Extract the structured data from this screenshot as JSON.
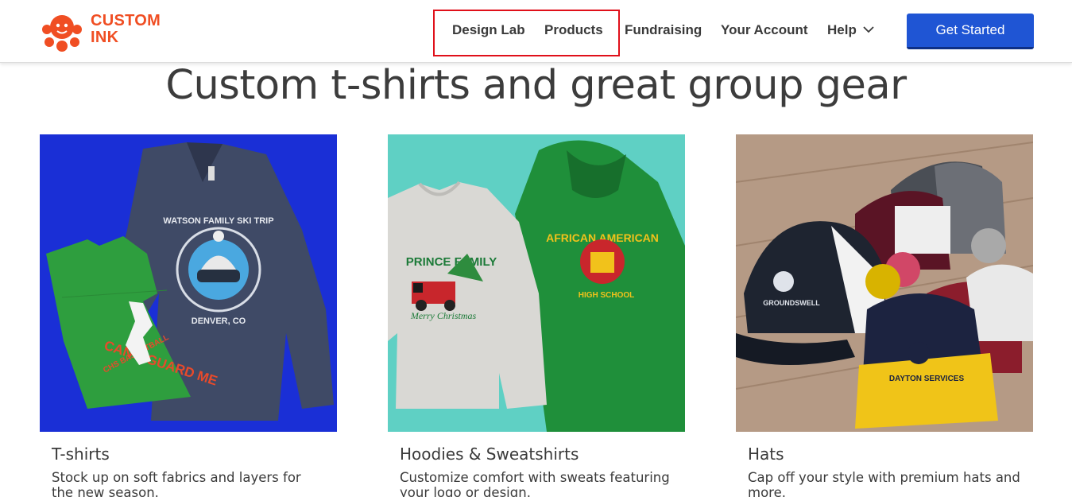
{
  "brand": {
    "name_line1": "CUSTOM",
    "name_line2": "INK",
    "color": "#f04e23",
    "icon": "octopus-logo-icon"
  },
  "nav": {
    "items": [
      {
        "label": "Design Lab"
      },
      {
        "label": "Products"
      },
      {
        "label": "Fundraising"
      },
      {
        "label": "Your Account"
      },
      {
        "label": "Help"
      }
    ],
    "help_icon": "chevron-down-icon",
    "cta_label": "Get Started",
    "cta_color": "#1f55d4",
    "highlight_color": "#e0101a"
  },
  "hero": {
    "title": "Custom t-shirts and great group gear"
  },
  "cards": [
    {
      "title": "T-shirts",
      "description": "Stock up on soft fabrics and layers for the new season.",
      "image": "tshirts-photo",
      "tee_green_text": "CAN'T GUARD ME",
      "tee_green_sub": "CHS BASKETBALL",
      "tee_navy_text": "WATSON FAMILY SKI TRIP",
      "tee_navy_sub": "DENVER, CO"
    },
    {
      "title": "Hoodies & Sweatshirts",
      "description": "Customize comfort with sweats featuring your logo or design.",
      "image": "hoodies-photo",
      "sweat_text": "PRINCE FAMILY",
      "sweat_sub": "Merry Christmas",
      "hoodie_text": "AFRICAN AMERICAN",
      "hoodie_sub": "HIGH SCHOOL"
    },
    {
      "title": "Hats",
      "description": "Cap off your style with premium hats and more.",
      "image": "hats-photo",
      "cap_text": "GROUNDSWELL",
      "beanie_text": "DAYTON SERVICES"
    }
  ]
}
